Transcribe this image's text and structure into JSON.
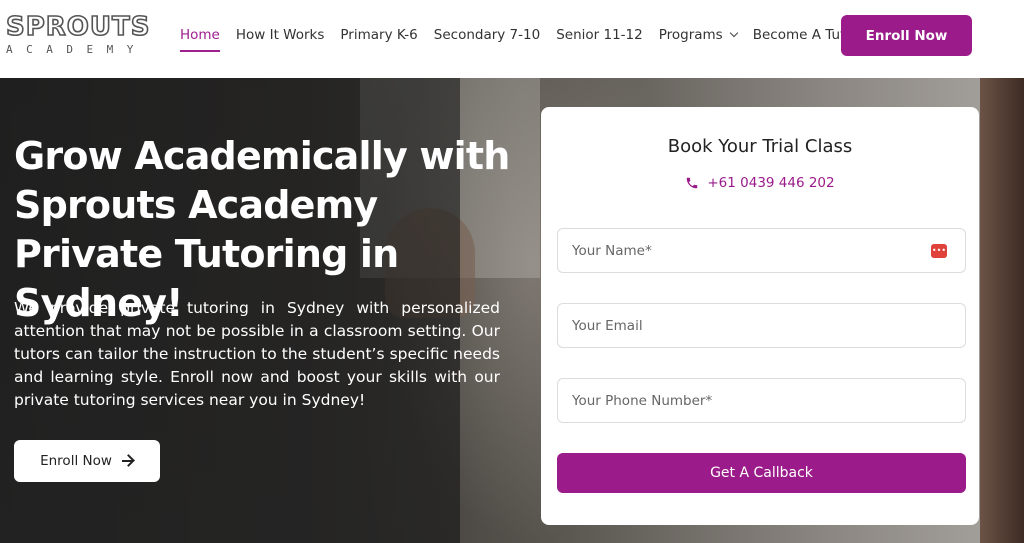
{
  "brand": {
    "name": "SPROUTS",
    "tagline": "ACADEMY"
  },
  "nav": {
    "items": [
      {
        "label": "Home",
        "active": true
      },
      {
        "label": "How It Works"
      },
      {
        "label": "Primary K-6"
      },
      {
        "label": "Secondary 7-10"
      },
      {
        "label": "Senior 11-12"
      },
      {
        "label": "Programs",
        "has_dropdown": true
      },
      {
        "label": "Become A Tutor"
      }
    ],
    "cta_label": "Enroll Now"
  },
  "hero": {
    "title": "Grow Academically with Sprouts Academy Private Tutoring in Sydney!",
    "body": "We provide private tutoring in Sydney with personalized attention that may not be possible in a classroom setting. Our tutors can tailor the instruction to the student’s specific needs and learning style. Enroll now and boost your skills with our private tutoring services near you in Sydney!",
    "cta_label": "Enroll Now"
  },
  "form": {
    "title": "Book Your Trial Class",
    "phone": "+61 0439 446 202",
    "name_placeholder": "Your Name*",
    "email_placeholder": "Your Email",
    "phone_placeholder": "Your Phone Number*",
    "submit_label": "Get A Callback"
  },
  "colors": {
    "accent": "#9b1b8b",
    "active_nav": "#9e1f8e"
  }
}
